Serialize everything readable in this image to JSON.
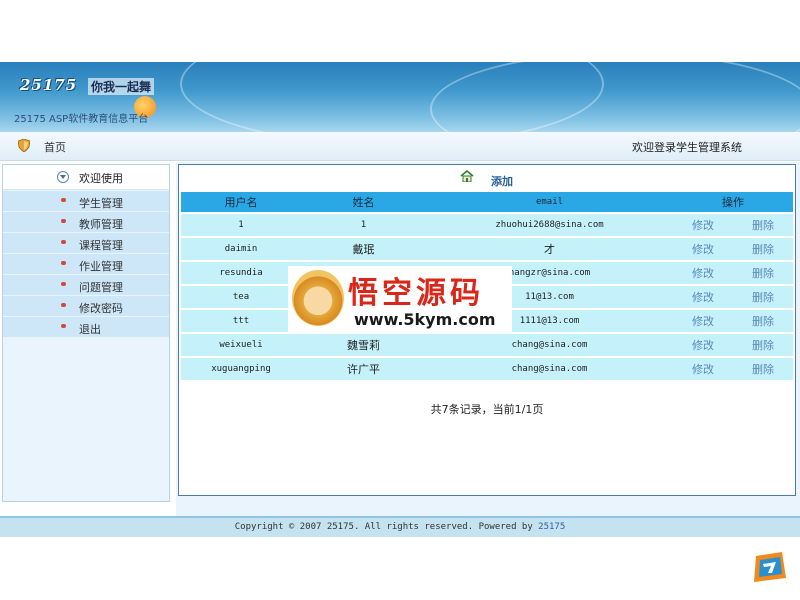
{
  "banner": {
    "logo_text": "25175",
    "slogan": "你我一起舞",
    "platform": "25175 ASP软件教育信息平台"
  },
  "navbar": {
    "home": "首页",
    "welcome": "欢迎登录学生管理系统"
  },
  "sidebar": {
    "header": "欢迎使用",
    "items": [
      {
        "label": "学生管理"
      },
      {
        "label": "教师管理"
      },
      {
        "label": "课程管理"
      },
      {
        "label": "作业管理"
      },
      {
        "label": "问题管理"
      },
      {
        "label": "修改密码"
      },
      {
        "label": "退出"
      }
    ]
  },
  "main": {
    "add_label": "添加",
    "columns": [
      "用户名",
      "姓名",
      "email",
      "操作"
    ],
    "rows": [
      {
        "username": "1",
        "name": "1",
        "email": "zhuohui2688@sina.com",
        "edit": "修改",
        "delete": "删除"
      },
      {
        "username": "daimin",
        "name": "戴珉",
        "email": "才",
        "edit": "修改",
        "delete": "删除"
      },
      {
        "username": "resundia",
        "name": "",
        "email": "hangzr@sina.com",
        "edit": "修改",
        "delete": "删除"
      },
      {
        "username": "tea",
        "name": "",
        "email": "11@13.com",
        "edit": "修改",
        "delete": "删除"
      },
      {
        "username": "ttt",
        "name": "",
        "email": "1111@13.com",
        "edit": "修改",
        "delete": "删除"
      },
      {
        "username": "weixueli",
        "name": "魏雪莉",
        "email": "chang@sina.com",
        "edit": "修改",
        "delete": "删除"
      },
      {
        "username": "xuguangping",
        "name": "许广平",
        "email": "chang@sina.com",
        "edit": "修改",
        "delete": "删除"
      }
    ],
    "summary": "共7条记录，当前1/1页"
  },
  "footer": {
    "text": "Copyright © 2007 25175. All rights reserved. Powered by ",
    "link": "25175"
  },
  "watermark": {
    "title": "悟空源码",
    "url": "www.5kym.com"
  }
}
